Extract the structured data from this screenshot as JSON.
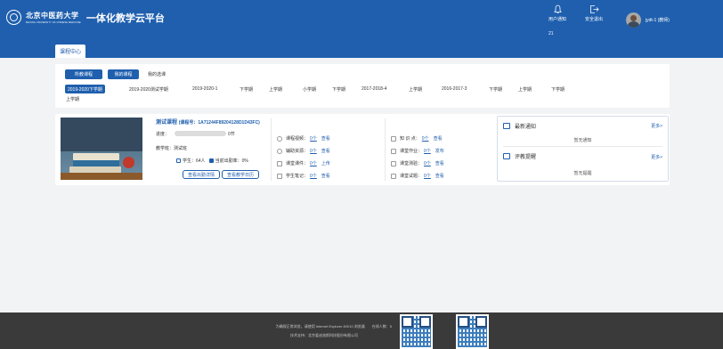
{
  "header": {
    "university_name": "北京中医药大学",
    "university_name_en": "BEIJING UNIVERSITY OF CHINESE MEDICINE",
    "platform_title": "一体化教学云平台",
    "notify_label": "用户通知",
    "notify_count": "21",
    "logout_label": "安全退出",
    "username": "jydt-1 (教师)"
  },
  "tabs": {
    "course_center": "课程中心"
  },
  "filters": {
    "all_courses": "所教课程",
    "my_courses": "我的课程",
    "my_selected": "我的选课",
    "terms": [
      "2019-2020下学期",
      "2019-2020测试学期",
      "2019-2020-1",
      "下学期",
      "上学期",
      "小学期",
      "下学期",
      "2017-2018-4",
      "上学期",
      "2016-2017-3",
      "下学期",
      "上学期",
      "下学期"
    ],
    "terms_overflow": "上学期"
  },
  "course": {
    "title": "测试课程",
    "code": "(课程号：1A71244F89204128D1D43FC)",
    "progress_label": "进度：",
    "progress_value": "0节",
    "progress_fraction": 0.0,
    "class_label": "教学班：测试班",
    "students": "学生：64人",
    "attendance": "当前出勤率：0%",
    "btn_attendance": "查看出勤详情",
    "btn_calendar": "查看教学日历",
    "resources_left": [
      {
        "label": "课程视频：",
        "count": "0个",
        "action": "查看"
      },
      {
        "label": "辅助资源：",
        "count": "0个",
        "action": "查看"
      },
      {
        "label": "课堂课件：",
        "count": "0个",
        "action": "上传"
      },
      {
        "label": "学生笔记：",
        "count": "0个",
        "action": "查看"
      }
    ],
    "resources_right": [
      {
        "label": "知 识 点：",
        "count": "0个",
        "action": "查看"
      },
      {
        "label": "课堂作业：",
        "count": "0个",
        "action": "发布"
      },
      {
        "label": "课堂测验：",
        "count": "0个",
        "action": "查看"
      },
      {
        "label": "课堂试题：",
        "count": "0个",
        "action": "查看"
      }
    ]
  },
  "side": {
    "news_title": "最新通知",
    "news_more": "更多>",
    "news_empty": "暂无通知",
    "eval_title": "评教提醒",
    "eval_more": "更多>",
    "eval_empty": "暂无提醒"
  },
  "footer": {
    "line1": "为确保正常浏览，请使用 Internet Explorer 8/9/10 浏览器　　在线人数：5",
    "line2": "技术支持：北京爱迪洛斯科技股份有限公司"
  },
  "colors": {
    "brand": "#1f5fae",
    "footer_bg": "#3a3a3a",
    "page_bg": "#f2f3f5"
  }
}
